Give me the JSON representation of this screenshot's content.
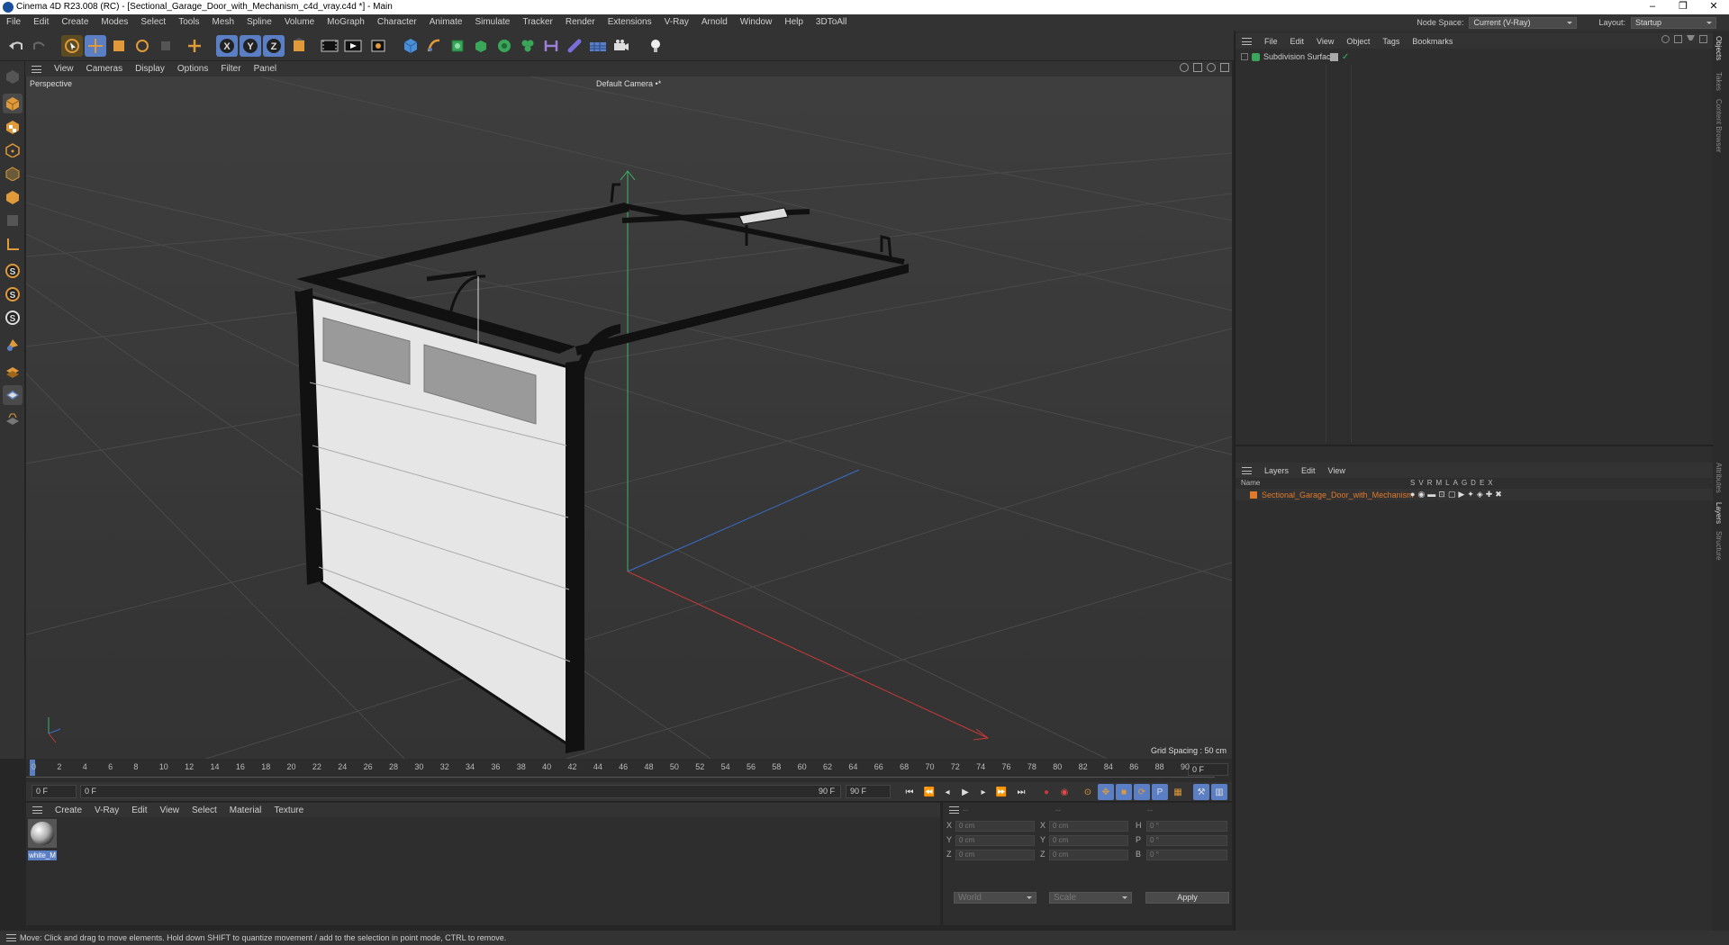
{
  "window": {
    "title": "Cinema 4D R23.008 (RC) - [Sectional_Garage_Door_with_Mechanism_c4d_vray.c4d *] - Main",
    "controls": [
      "–",
      "❐",
      "✕"
    ]
  },
  "menubar": [
    "File",
    "Edit",
    "Create",
    "Modes",
    "Select",
    "Tools",
    "Mesh",
    "Spline",
    "Volume",
    "MoGraph",
    "Character",
    "Animate",
    "Simulate",
    "Tracker",
    "Render",
    "Extensions",
    "V-Ray",
    "Arnold",
    "Window",
    "Help",
    "3DToAll"
  ],
  "nodespace": {
    "label": "Node Space:",
    "value": "Current (V-Ray)",
    "layout_label": "Layout:",
    "layout_value": "Startup"
  },
  "viewport": {
    "menu": [
      "View",
      "Cameras",
      "Display",
      "Options",
      "Filter",
      "Panel"
    ],
    "label": "Perspective",
    "camera": "Default Camera",
    "camera_mark": "•*",
    "grid_spacing": "Grid Spacing : 50 cm"
  },
  "timeline": {
    "ticks": [
      "0",
      "2",
      "4",
      "6",
      "8",
      "10",
      "12",
      "14",
      "16",
      "18",
      "20",
      "22",
      "24",
      "26",
      "28",
      "30",
      "32",
      "34",
      "36",
      "38",
      "40",
      "42",
      "44",
      "46",
      "48",
      "50",
      "52",
      "54",
      "56",
      "58",
      "60",
      "62",
      "64",
      "66",
      "68",
      "70",
      "72",
      "74",
      "76",
      "78",
      "80",
      "82",
      "84",
      "86",
      "88",
      "90"
    ],
    "current_frame": "0 F"
  },
  "controls": {
    "start": "0 F",
    "min": "0 F",
    "max": "90 F",
    "end": "90 F"
  },
  "material_manager": {
    "menu": [
      "Create",
      "V-Ray",
      "Edit",
      "View",
      "Select",
      "Material",
      "Texture"
    ],
    "materials": [
      {
        "name": "white_M"
      }
    ]
  },
  "coordinates": {
    "header": "--",
    "col2_header": "--",
    "col3_header": "--",
    "rows": [
      {
        "a": "X",
        "av": "0 cm",
        "b": "X",
        "bv": "0 cm",
        "c": "H",
        "cv": "0 °"
      },
      {
        "a": "Y",
        "av": "0 cm",
        "b": "Y",
        "bv": "0 cm",
        "c": "P",
        "cv": "0 °"
      },
      {
        "a": "Z",
        "av": "0 cm",
        "b": "Z",
        "bv": "0 cm",
        "c": "B",
        "cv": "0 °"
      }
    ],
    "mode": "World",
    "mode2": "Scale",
    "apply": "Apply"
  },
  "objects_panel": {
    "menu": [
      "File",
      "Edit",
      "View",
      "Object",
      "Tags",
      "Bookmarks"
    ],
    "items": [
      {
        "name": "Subdivision Surface"
      }
    ]
  },
  "layers_panel": {
    "menu": [
      "Layers",
      "Edit",
      "View"
    ],
    "col_name": "Name",
    "flags": [
      "S",
      "V",
      "R",
      "M",
      "L",
      "A",
      "G",
      "D",
      "E",
      "X"
    ],
    "items": [
      {
        "name": "Sectional_Garage_Door_with_Mechanism",
        "color": "#e07a2a"
      }
    ]
  },
  "sidetabs_top": [
    "Objects",
    "Takes",
    "Content Browser"
  ],
  "sidetabs_bottom": [
    "Attributes",
    "Layers",
    "Structure"
  ],
  "status": "Move: Click and drag to move elements. Hold down SHIFT to quantize movement / add to the selection in point mode, CTRL to remove.",
  "colors": {
    "accent": "#e07a2a",
    "selection": "#5b7fc4",
    "axis_x": "#c83a3a",
    "axis_y": "#3ab46a",
    "axis_z": "#3a6ec8"
  }
}
